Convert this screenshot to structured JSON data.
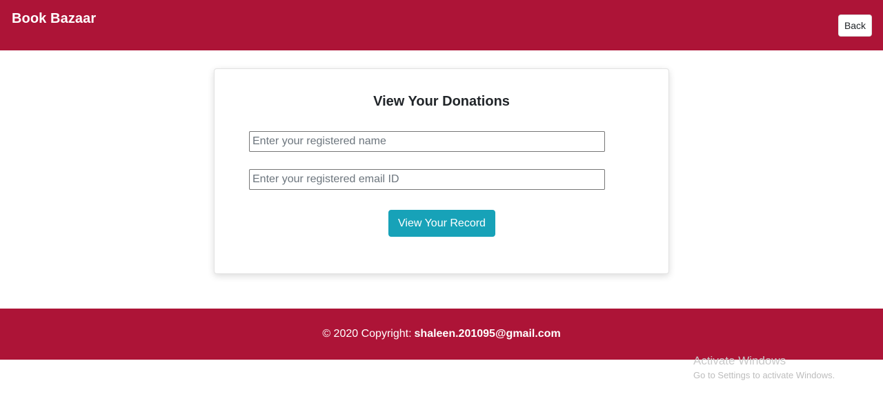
{
  "navbar": {
    "brand": "Book Bazaar",
    "back_label": "Back"
  },
  "card": {
    "title": "View Your Donations",
    "name_field": {
      "value": "",
      "placeholder": "Enter your registered name"
    },
    "email_field": {
      "value": "",
      "placeholder": "Enter your registered email ID"
    },
    "submit_label": "View Your Record"
  },
  "footer": {
    "copyright": "© 2020 Copyright:",
    "email": "shaleen.201095@gmail.com"
  },
  "watermark": {
    "title": "Activate Windows",
    "subtitle": "Go to Settings to activate Windows."
  },
  "colors": {
    "brand": "#ad1437",
    "accent": "#17a2b8"
  }
}
